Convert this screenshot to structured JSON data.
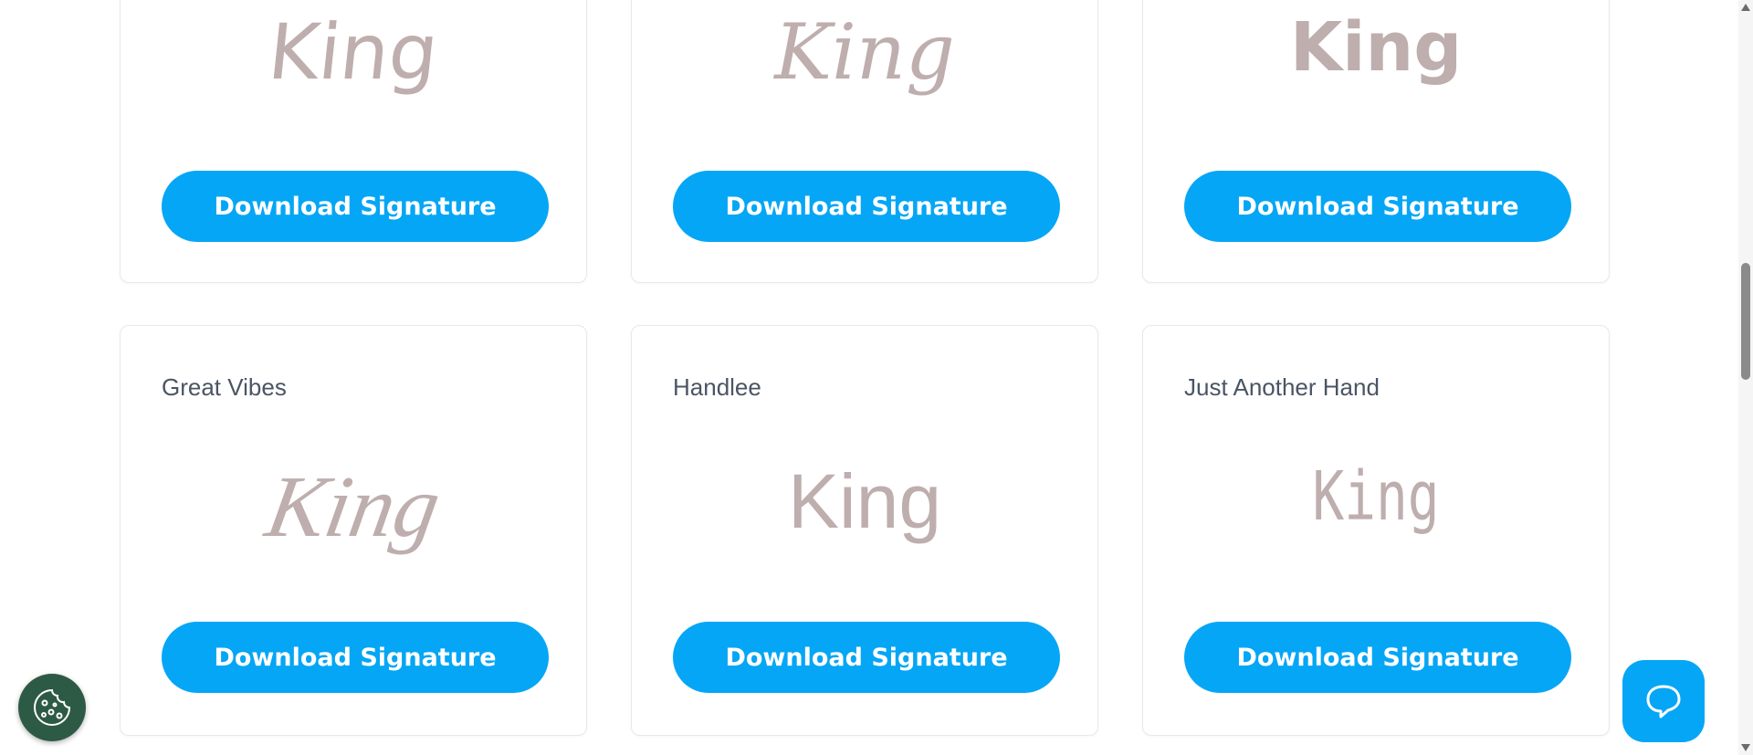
{
  "cards": [
    {
      "font_name": "",
      "preview_text": "King",
      "button_label": "Download Signature"
    },
    {
      "font_name": "",
      "preview_text": "King",
      "button_label": "Download Signature"
    },
    {
      "font_name": "",
      "preview_text": "King",
      "button_label": "Download Signature"
    },
    {
      "font_name": "Great Vibes",
      "preview_text": "King",
      "button_label": "Download Signature"
    },
    {
      "font_name": "Handlee",
      "preview_text": "King",
      "button_label": "Download Signature"
    },
    {
      "font_name": "Just Another Hand",
      "preview_text": "King",
      "button_label": "Download Signature"
    }
  ],
  "colors": {
    "button_bg": "#05a6f5",
    "signature_text": "#bfaeae",
    "font_name_text": "#4a5564",
    "cookie_bg": "#2d5a44"
  },
  "icons": {
    "cookie": "cookie-icon",
    "chat": "chat-bubble-icon"
  }
}
